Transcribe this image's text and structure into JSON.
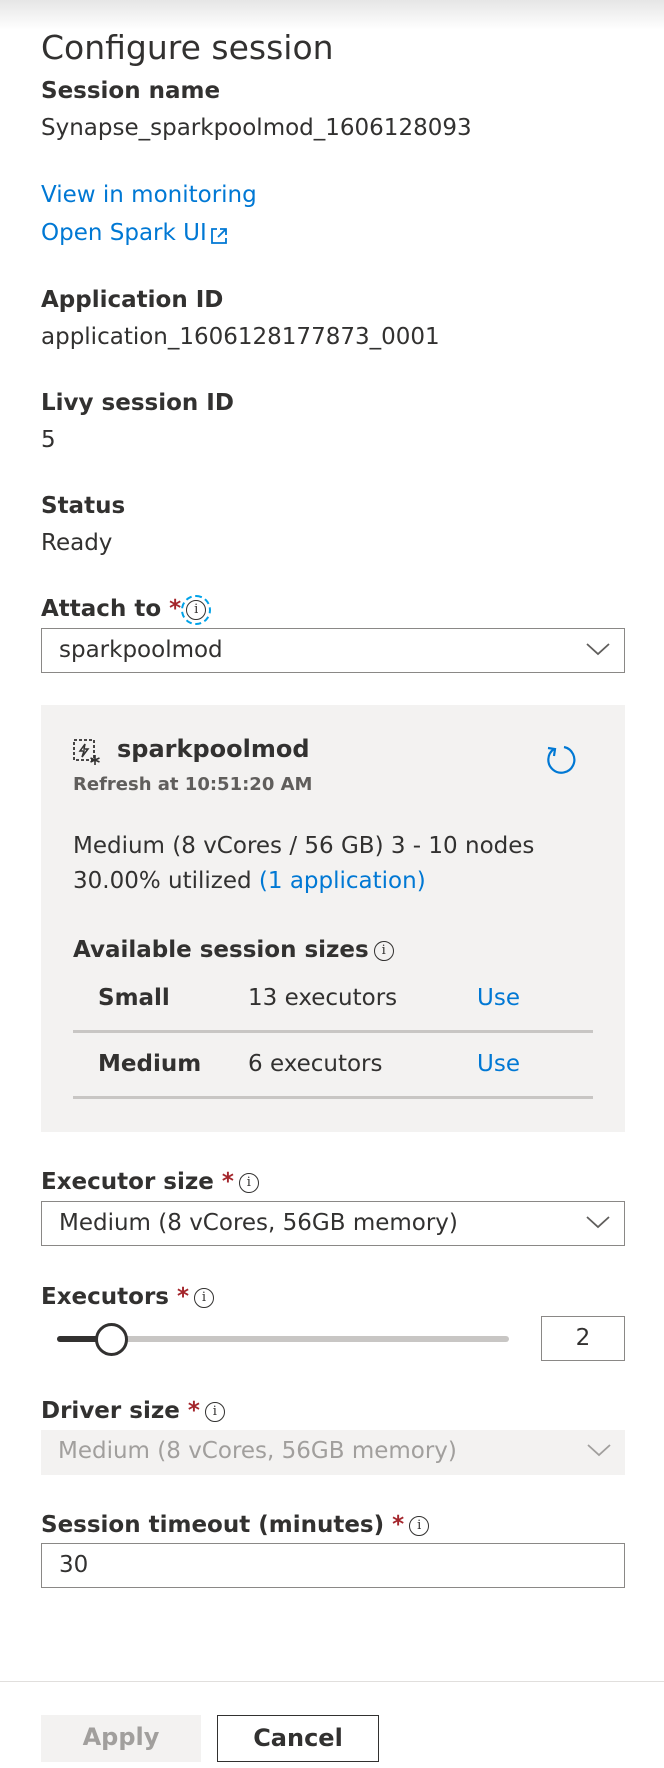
{
  "title": "Configure session",
  "session_name": {
    "label": "Session name",
    "value": "Synapse_sparkpoolmod_1606128093"
  },
  "links": {
    "monitoring": "View in monitoring",
    "spark_ui": "Open Spark UI"
  },
  "application_id": {
    "label": "Application ID",
    "value": "application_1606128177873_0001"
  },
  "livy_session_id": {
    "label": "Livy session ID",
    "value": "5"
  },
  "status": {
    "label": "Status",
    "value": "Ready"
  },
  "attach_to": {
    "label": "Attach to",
    "required": "*",
    "value": "sparkpoolmod"
  },
  "pool_card": {
    "name": "sparkpoolmod",
    "refresh": "Refresh at 10:51:20 AM",
    "size_line": "Medium (8 vCores / 56 GB) 3 - 10 nodes",
    "utilized": "30.00% utilized",
    "applications_link": "(1 application)",
    "sizes_label": "Available session sizes",
    "sizes": [
      {
        "name": "Small",
        "executors": "13 executors",
        "action": "Use"
      },
      {
        "name": "Medium",
        "executors": "6 executors",
        "action": "Use"
      }
    ]
  },
  "executor_size": {
    "label": "Executor size",
    "required": "*",
    "value": "Medium (8 vCores, 56GB memory)"
  },
  "executors": {
    "label": "Executors",
    "required": "*",
    "value": "2",
    "slider_fraction": 0.12
  },
  "driver_size": {
    "label": "Driver size",
    "required": "*",
    "value": "Medium (8 vCores, 56GB memory)"
  },
  "session_timeout": {
    "label": "Session timeout (minutes)",
    "required": "*",
    "value": "30"
  },
  "buttons": {
    "apply": "Apply",
    "cancel": "Cancel"
  },
  "colors": {
    "link": "#0078d4",
    "required": "#a4262c",
    "card_bg": "#f3f2f1"
  },
  "icons": {
    "info": "info-icon",
    "chevron": "chevron-down-icon",
    "pool": "spark-pool-icon",
    "refresh": "refresh-icon",
    "external": "external-link-icon"
  }
}
